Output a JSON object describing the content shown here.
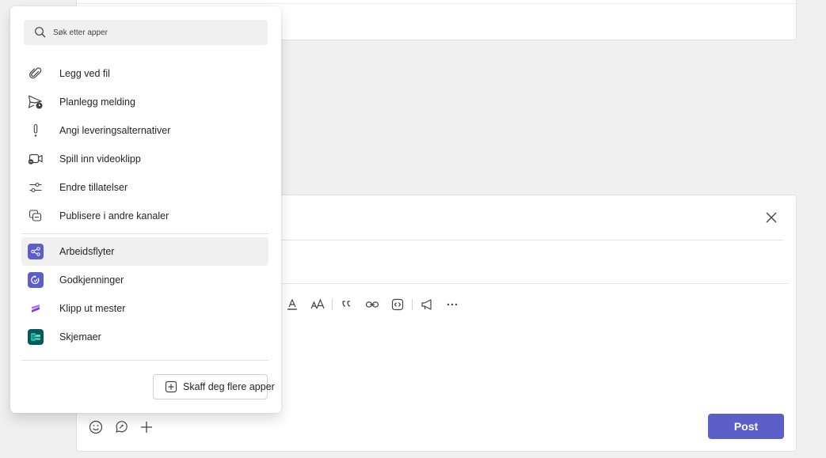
{
  "search": {
    "placeholder": "Søk etter apper"
  },
  "menu_items": [
    {
      "label": "Legg ved fil",
      "icon": "paperclip-icon"
    },
    {
      "label": "Planlegg melding",
      "icon": "send-clock-icon"
    },
    {
      "label": "Angi leveringsalternativer",
      "icon": "exclamation-icon"
    },
    {
      "label": "Spill inn videoklipp",
      "icon": "video-clip-icon"
    },
    {
      "label": "Endre tillatelser",
      "icon": "sliders-icon"
    },
    {
      "label": "Publisere i andre kanaler",
      "icon": "copy-post-icon"
    }
  ],
  "apps": [
    {
      "label": "Arbeidsflyter",
      "icon": "workflows-icon",
      "color": "#5b5fc7"
    },
    {
      "label": "Godkjenninger",
      "icon": "approvals-icon",
      "color": "#5b5fc7"
    },
    {
      "label": "Klipp ut mester",
      "icon": "clipchamp-icon",
      "color": "#7b3fe4"
    },
    {
      "label": "Skjemaer",
      "icon": "forms-icon",
      "color": "#035a5a"
    }
  ],
  "more_apps_label": "Skaff deg flere apper",
  "post_label": "Post",
  "colors": {
    "accent": "#5b5fc7",
    "hover": "#f0f0f0"
  }
}
